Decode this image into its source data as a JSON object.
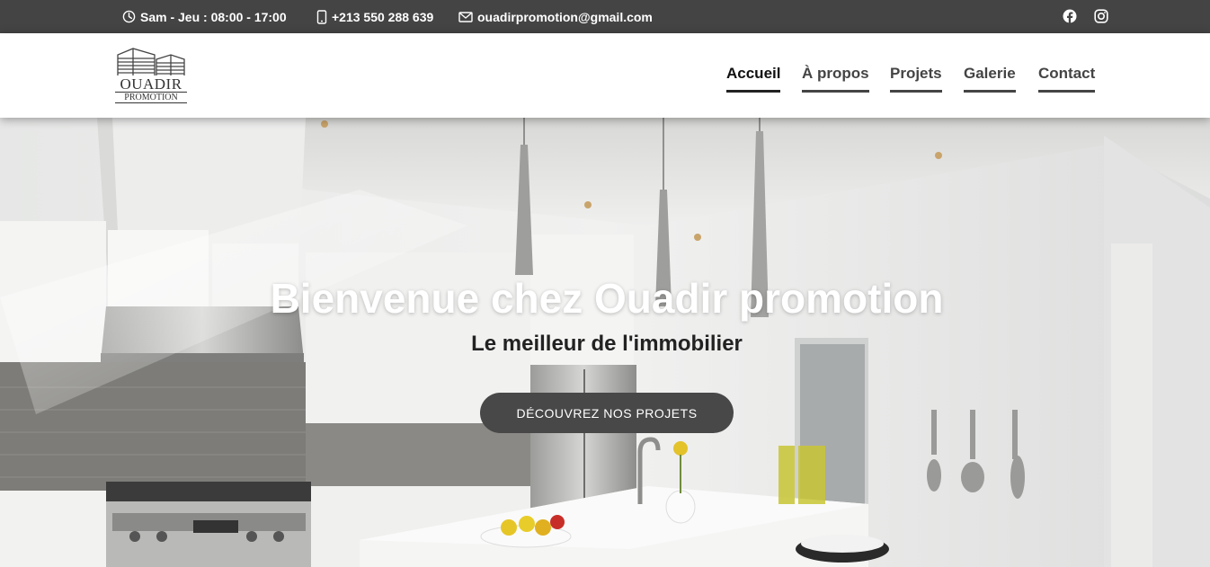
{
  "topbar": {
    "hours": "Sam - Jeu : 08:00 - 17:00",
    "phone": "+213 550 288 639",
    "email": "ouadirpromotion@gmail.com",
    "icons": [
      "clock-icon",
      "phone-icon",
      "mail-icon",
      "facebook-icon",
      "instagram-icon"
    ],
    "background": "#444444"
  },
  "logo": {
    "line1": "OUADIR",
    "line2": "PROMOTION"
  },
  "nav": {
    "items": [
      {
        "label": "Accueil",
        "active": true
      },
      {
        "label": "À propos",
        "active": false
      },
      {
        "label": "Projets",
        "active": false
      },
      {
        "label": "Galerie",
        "active": false
      },
      {
        "label": "Contact",
        "active": false
      }
    ]
  },
  "hero": {
    "title": "Bienvenue chez Ouadir promotion",
    "subtitle": "Le meilleur de l'immobilier",
    "cta_label": "DÉCOUVREZ NOS PROJETS",
    "cta_color": "#484848"
  }
}
